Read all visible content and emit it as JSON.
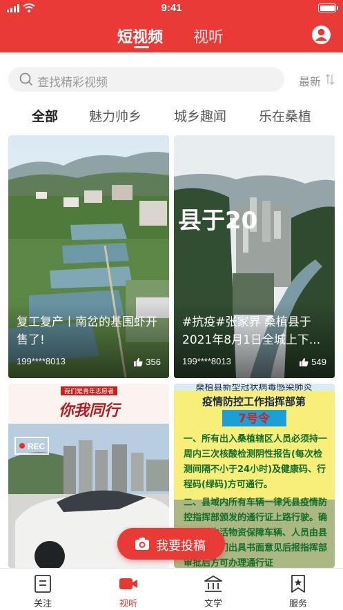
{
  "status_bar": {
    "time": "9:41"
  },
  "header": {
    "tabs": [
      {
        "label": "短视频"
      },
      {
        "label": "视听"
      }
    ],
    "active_tab": "短视频",
    "profile_icon": "user-icon"
  },
  "search": {
    "placeholder": "查找精彩视频",
    "sort_label": "最新"
  },
  "categories": [
    {
      "label": "全部"
    },
    {
      "label": "魅力帅乡"
    },
    {
      "label": "城乡趣闻"
    },
    {
      "label": "乐在桑植"
    }
  ],
  "videos": [
    {
      "title": "复工复产丨南岔的基围虾开售了!",
      "user": "199****8013",
      "likes": "356"
    },
    {
      "title": "#抗疫#张家界 桑植县于2021年8月1日全城上下...",
      "user": "199****8013",
      "likes": "549",
      "overlay_text": "县于20"
    },
    {
      "banner": "我们是青年志愿者",
      "slogan": "你我同行",
      "badge": "REC"
    },
    {
      "notice_top": "桑植县新型冠状病毒感染肺炎",
      "notice_head": "疫情防控工作指挥部第",
      "notice_no": "7号令",
      "notice_p1": "一、所有出入桑植辖区人员必须持一周内三次核酸检测阴性报告(每次检测间隔不小于24小时)及健康码、行程码(绿码)方可通行。",
      "notice_p2": "二、县域内所有车辆一律凭县疫情防控指挥部颁发的通行证上路行驶。确需运送生活物资保障车辆、人员由县直主管部门出具书面意见后报指挥部审批后方可办理通行证"
    }
  ],
  "post_button": {
    "label": "我要投稿"
  },
  "bottom_nav": [
    {
      "label": "关注"
    },
    {
      "label": "视听"
    },
    {
      "label": "文学"
    },
    {
      "label": "服务"
    }
  ],
  "colors": {
    "brand_red": "#ea3a36",
    "active_nav": "#e63a2f",
    "notice_yellow": "#f7ef7a"
  }
}
